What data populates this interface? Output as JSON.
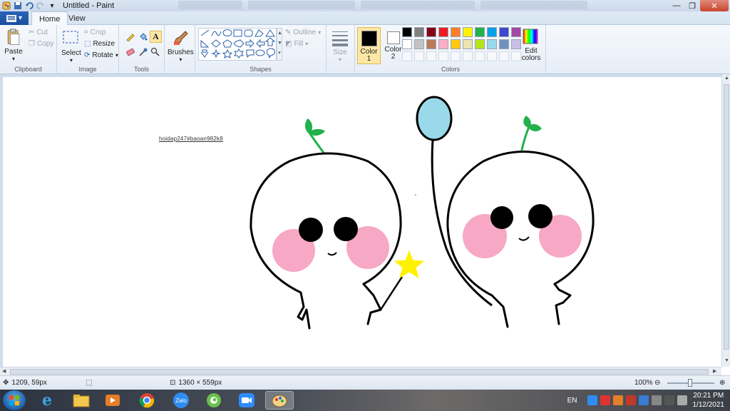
{
  "window": {
    "title": "Untitled - Paint",
    "controls": [
      "minimize",
      "maximize",
      "close"
    ]
  },
  "tabs": [
    {
      "label": "Home",
      "active": true
    },
    {
      "label": "View",
      "active": false
    }
  ],
  "ribbon": {
    "clipboard": {
      "label": "Clipboard",
      "paste": "Paste",
      "cut": "Cut",
      "copy": "Copy"
    },
    "image": {
      "label": "Image",
      "select": "Select",
      "crop": "Crop",
      "resize": "Resize",
      "rotate": "Rotate"
    },
    "tools": {
      "label": "Tools"
    },
    "brushes": {
      "label": "Brushes"
    },
    "shapes": {
      "label": "Shapes",
      "outline": "Outline",
      "fill": "Fill"
    },
    "size": {
      "label": "Size"
    },
    "colors": {
      "label": "Colors",
      "color1": "Color\n1",
      "color2": "Color\n2",
      "edit": "Edit colors",
      "color1_value": "#000000",
      "color2_value": "#ffffff",
      "palette_row1": [
        "#000000",
        "#7f7f7f",
        "#880015",
        "#ed1c24",
        "#ff7f27",
        "#fff200",
        "#22b14c",
        "#00a2e8",
        "#3f48cc",
        "#a349a4"
      ],
      "palette_row2": [
        "#ffffff",
        "#c3c3c3",
        "#b97a57",
        "#ffaec9",
        "#ffc90e",
        "#efe4b0",
        "#b5e61d",
        "#99d9ea",
        "#7092be",
        "#c8bfe7"
      ]
    }
  },
  "canvas": {
    "watermark": "hoidap247#baoan982k8",
    "colors": {
      "outline": "#000000",
      "cheek": "#f7a8c4",
      "sprout": "#22b14c",
      "balloon": "#99d9ea",
      "star": "#fff200"
    }
  },
  "status": {
    "cursor": "1209, 59px",
    "dimensions": "1360 × 559px",
    "zoom": "100%"
  },
  "taskbar": {
    "apps": [
      "start-icon",
      "ie-icon",
      "explorer-icon",
      "media-icon",
      "chrome-icon",
      "zalo-icon",
      "coccoc-icon",
      "zoom-icon",
      "paint-icon"
    ],
    "zalo_label": "Zalo",
    "language": "EN",
    "time": "20:21 PM",
    "date": "1/12/2021"
  }
}
